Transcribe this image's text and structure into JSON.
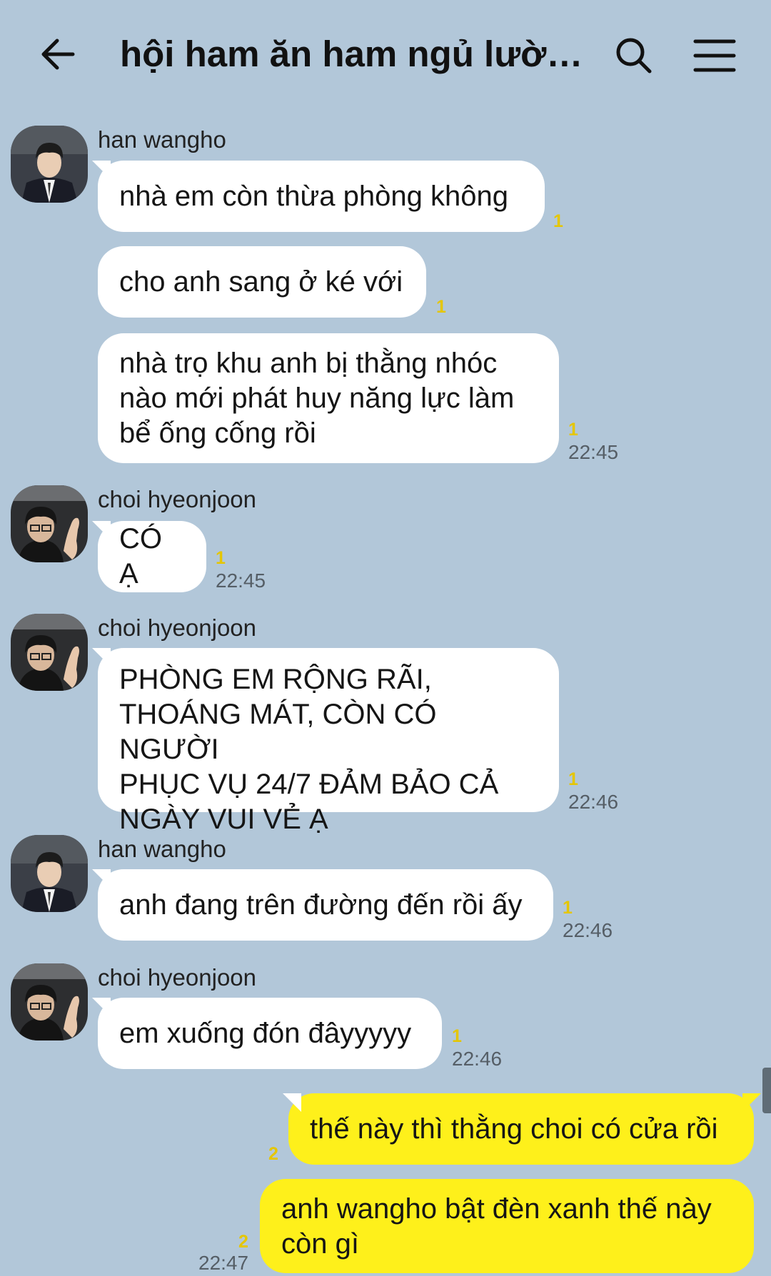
{
  "header": {
    "title": "hội ham ăn ham ngủ lười l...",
    "back_icon": "arrow-left-icon",
    "search_icon": "search-icon",
    "menu_icon": "hamburger-menu-icon"
  },
  "colors": {
    "background": "#b2c7d9",
    "incoming_bubble": "#ffffff",
    "outgoing_bubble": "#fef01b",
    "unread": "#e5c600"
  },
  "messages": [
    {
      "sender": "han wangho",
      "text": "nhà em còn thừa phòng không",
      "unread": "1"
    },
    {
      "text": "cho anh sang ở ké với",
      "unread": "1"
    },
    {
      "text": "nhà trọ khu anh bị thằng nhóc nào mới phát huy năng lực làm bể ống cống rồi",
      "lines": [
        "nhà trọ khu anh bị thằng nhóc",
        "nào mới phát huy năng lực làm",
        "bể ống cống rồi"
      ],
      "unread": "1",
      "time": "22:45"
    },
    {
      "sender": "choi hyeonjoon",
      "text": "CÓ Ạ",
      "unread": "1",
      "time": "22:45"
    },
    {
      "sender": "choi hyeonjoon",
      "lines": [
        "PHÒNG EM RỘNG RÃI,",
        "THOÁNG MÁT, CÒN CÓ NGƯỜI",
        "PHỤC VỤ 24/7 ĐẢM BẢO CẢ",
        "NGÀY VUI VẺ Ạ"
      ],
      "unread": "1",
      "time": "22:46"
    },
    {
      "sender": "han wangho",
      "text": "anh đang trên đường đến rồi ấy",
      "unread": "1",
      "time": "22:46"
    },
    {
      "sender": "choi hyeonjoon",
      "text": "em xuống đón đâyyyyy",
      "unread": "1",
      "time": "22:46"
    },
    {
      "text": "thế này thì thằng choi có cửa rồi",
      "unread": "2"
    },
    {
      "lines": [
        "anh wangho bật đèn xanh thế này",
        "còn gì"
      ],
      "unread": "2",
      "time": "22:47"
    }
  ]
}
